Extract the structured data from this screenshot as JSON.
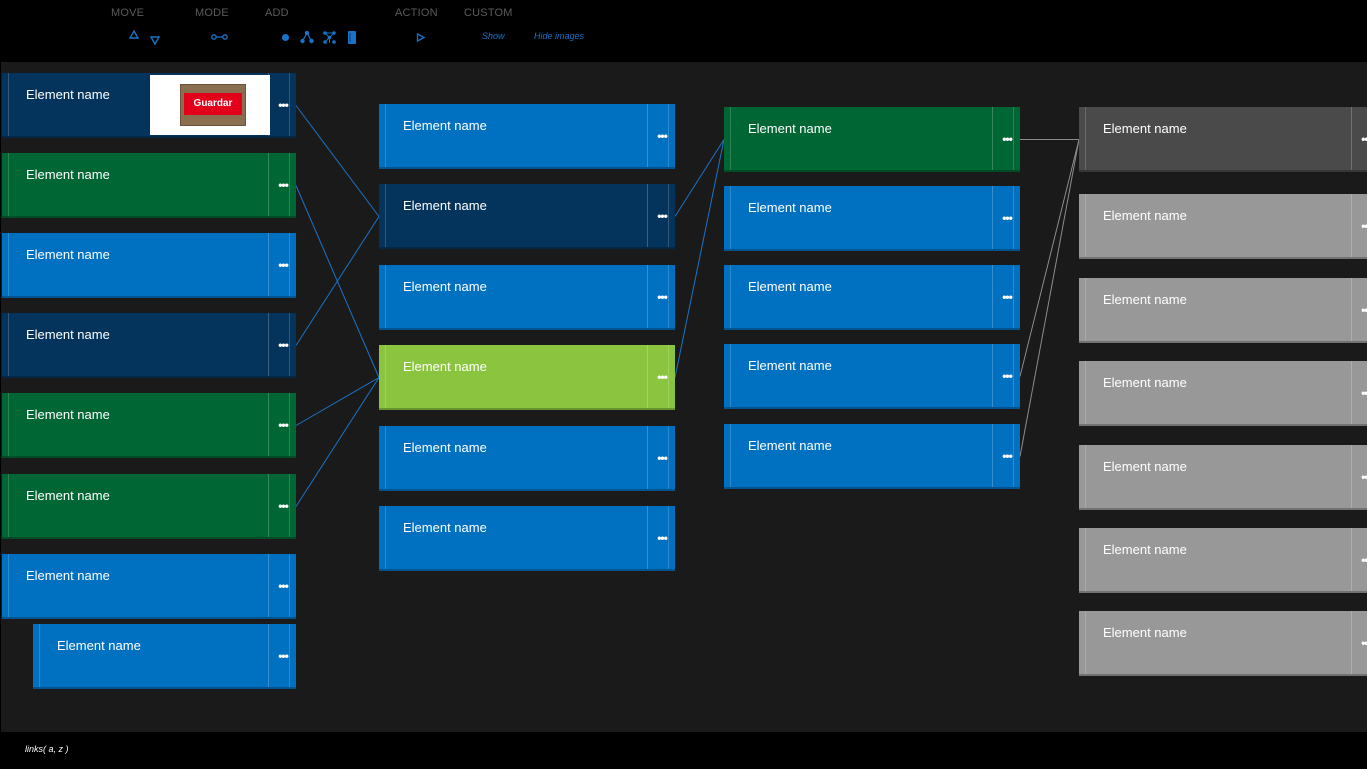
{
  "toolbar": {
    "groups": {
      "move": "MOVE",
      "mode": "MODE",
      "add": "ADD",
      "action": "ACTION",
      "custom": "CUSTOM"
    },
    "show_label": "Show",
    "hide_images_label": "Hide images"
  },
  "icons": {
    "move_up": "arrow-up-outline-icon",
    "move_down": "arrow-down-outline-icon",
    "mode": "link-mode-icon",
    "add_dot": "add-node-icon",
    "add_tree": "add-tree-icon",
    "add_network": "add-network-icon",
    "add_document": "add-document-icon",
    "action_play": "play-icon"
  },
  "colors": {
    "dark_blue": "#04345c",
    "green": "#006633",
    "blue": "#0070c0",
    "lime": "#8bc53f",
    "charcoal": "#4a4a4a",
    "grey": "#989898",
    "link_blue": "#1a73c8",
    "link_grey": "#8c8c8c"
  },
  "thumbnail": {
    "button_label": "Guardar"
  },
  "menu_glyph": "•••",
  "columns": [
    {
      "nodes": [
        {
          "name": "Element name",
          "color": "dark",
          "thumbnail": true
        },
        {
          "name": "Element name",
          "color": "green"
        },
        {
          "name": "Element name",
          "color": "blue"
        },
        {
          "name": "Element name",
          "color": "dark"
        },
        {
          "name": "Element name",
          "color": "green"
        },
        {
          "name": "Element name",
          "color": "green"
        },
        {
          "name": "Element name",
          "color": "blue"
        },
        {
          "name": "Element name",
          "color": "blue",
          "child": true
        }
      ]
    },
    {
      "nodes": [
        {
          "name": "Element name",
          "color": "blue"
        },
        {
          "name": "Element name",
          "color": "dark"
        },
        {
          "name": "Element name",
          "color": "blue"
        },
        {
          "name": "Element name",
          "color": "lime"
        },
        {
          "name": "Element name",
          "color": "blue"
        },
        {
          "name": "Element name",
          "color": "blue"
        }
      ]
    },
    {
      "nodes": [
        {
          "name": "Element name",
          "color": "green"
        },
        {
          "name": "Element name",
          "color": "blue"
        },
        {
          "name": "Element name",
          "color": "blue"
        },
        {
          "name": "Element name",
          "color": "blue"
        },
        {
          "name": "Element name",
          "color": "blue"
        }
      ]
    },
    {
      "nodes": [
        {
          "name": "Element name",
          "color": "charc"
        },
        {
          "name": "Element name",
          "color": "grey"
        },
        {
          "name": "Element name",
          "color": "grey"
        },
        {
          "name": "Element name",
          "color": "grey"
        },
        {
          "name": "Element name",
          "color": "grey"
        },
        {
          "name": "Element name",
          "color": "grey"
        },
        {
          "name": "Element name",
          "color": "grey"
        }
      ]
    }
  ],
  "links": [
    {
      "from": [
        0,
        0
      ],
      "to": [
        1,
        1
      ],
      "color": "link_blue"
    },
    {
      "from": [
        0,
        1
      ],
      "to": [
        1,
        3
      ],
      "color": "link_blue"
    },
    {
      "from": [
        0,
        3
      ],
      "to": [
        1,
        1
      ],
      "color": "link_blue"
    },
    {
      "from": [
        0,
        4
      ],
      "to": [
        1,
        3
      ],
      "color": "link_blue"
    },
    {
      "from": [
        0,
        5
      ],
      "to": [
        1,
        3
      ],
      "color": "link_blue"
    },
    {
      "from": [
        1,
        1
      ],
      "to": [
        2,
        0
      ],
      "color": "link_blue"
    },
    {
      "from": [
        1,
        3
      ],
      "to": [
        2,
        0
      ],
      "color": "link_blue"
    },
    {
      "from": [
        2,
        0
      ],
      "to": [
        3,
        0
      ],
      "color": "link_grey"
    },
    {
      "from": [
        2,
        3
      ],
      "to": [
        3,
        0
      ],
      "color": "link_grey"
    },
    {
      "from": [
        2,
        4
      ],
      "to": [
        3,
        0
      ],
      "color": "link_grey"
    }
  ],
  "footer": {
    "status": "links( a, z )"
  }
}
